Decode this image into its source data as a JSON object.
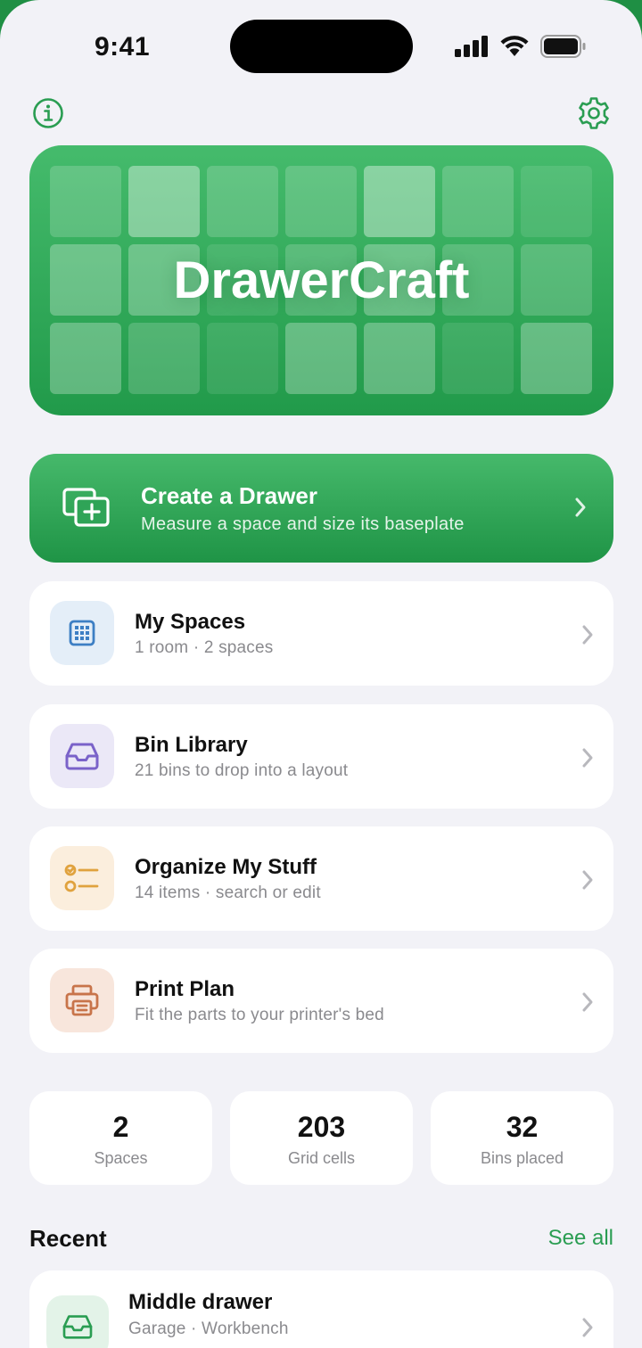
{
  "status_bar": {
    "time": "9:41"
  },
  "header": {
    "info_icon": "info-icon",
    "settings_icon": "gear-icon"
  },
  "hero": {
    "title": "DrawerCraft"
  },
  "create": {
    "title": "Create a Drawer",
    "subtitle": "Measure a space and size its baseplate",
    "icon": "add-drawer-icon"
  },
  "menu": [
    {
      "title": "My Spaces",
      "subtitle": "1 room · 2 spaces",
      "icon": "grid-icon",
      "color": "#3d7fc4",
      "bg": "#e4eef8"
    },
    {
      "title": "Bin Library",
      "subtitle": "21 bins to drop into a layout",
      "icon": "tray-icon",
      "color": "#7a62c9",
      "bg": "#ebe8f7"
    },
    {
      "title": "Organize My Stuff",
      "subtitle": "14 items · search or edit",
      "icon": "checklist-icon",
      "color": "#e0a23e",
      "bg": "#fbeedd"
    },
    {
      "title": "Print Plan",
      "subtitle": "Fit the parts to your printer's bed",
      "icon": "printer-icon",
      "color": "#c8744a",
      "bg": "#f8e6dc"
    }
  ],
  "stats": [
    {
      "value": "2",
      "label": "Spaces"
    },
    {
      "value": "203",
      "label": "Grid cells"
    },
    {
      "value": "32",
      "label": "Bins placed"
    }
  ],
  "recent": {
    "heading": "Recent",
    "see_all": "See all",
    "items": [
      {
        "title": "Middle drawer",
        "subtitle": "Garage · Workbench",
        "icon": "tray-icon"
      }
    ]
  },
  "colors": {
    "accent": "#2a9d52",
    "background": "#f2f2f7"
  }
}
